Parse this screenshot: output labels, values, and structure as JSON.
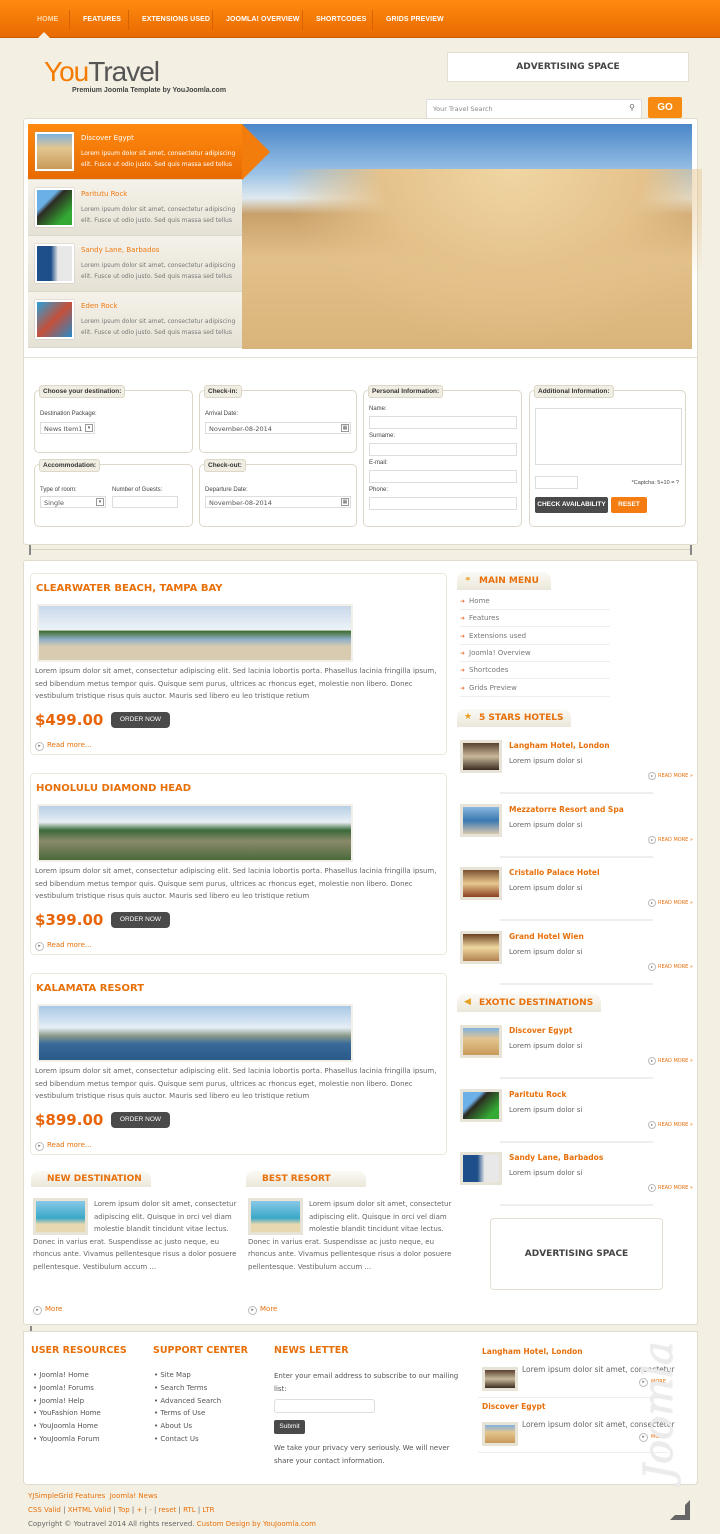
{
  "nav": {
    "items": [
      "Home",
      "Features",
      "Extensions used",
      "Joomla! Overview",
      "Shortcodes",
      "Grids Preview"
    ]
  },
  "header": {
    "logo_a": "You",
    "logo_b": "Travel",
    "tagline": "Premium Joomla Template by YouJoomla.com",
    "ad": "ADVERTISING SPACE",
    "search_placeholder": "Your Travel Search",
    "go": "GO"
  },
  "slider": {
    "items": [
      {
        "title": "Discover Egypt",
        "text": "Lorem ipsum dolor sit amet, consectetur adipiscing elit. Fusce ut odio justo. Sed quis massa sed tellus"
      },
      {
        "title": "Paritutu Rock",
        "text": "Lorem ipsum dolor sit amet, consectetur adipiscing elit. Fusce ut odio justo. Sed quis massa sed tellus"
      },
      {
        "title": "Sandy Lane, Barbados",
        "text": "Lorem ipsum dolor sit amet, consectetur adipiscing elit. Fusce ut odio justo. Sed quis massa sed tellus"
      },
      {
        "title": "Eden Rock",
        "text": "Lorem ipsum dolor sit amet, consectetur adipiscing elit. Fusce ut odio justo. Sed quis massa sed tellus"
      }
    ]
  },
  "booking": {
    "destination": {
      "legend": "Choose your destination:",
      "label": "Destination Package:",
      "value": "News Item1"
    },
    "checkin": {
      "legend": "Check-in:",
      "label": "Arrival Date:",
      "value": "November-08-2014"
    },
    "accommodation": {
      "legend": "Accommodation:",
      "room_label": "Type of room:",
      "room_value": "Single",
      "guests_label": "Number of Guests:"
    },
    "checkout": {
      "legend": "Check-out:",
      "label": "Departure Date:",
      "value": "November-08-2014"
    },
    "personal": {
      "legend": "Personal Information:",
      "name": "Name:",
      "surname": "Surname:",
      "email": "E-mail:",
      "phone": "Phone:"
    },
    "additional": {
      "legend": "Additional Information:",
      "captcha": "*Captcha: 5+10 = ?",
      "check": "CHECK AVAILABILITY",
      "reset": "RESET"
    }
  },
  "articles": [
    {
      "title": "CLEARWATER BEACH, TAMPA BAY",
      "text": "Lorem ipsum dolor sit amet, consectetur adipiscing elit. Sed lacinia lobortis porta. Phasellus lacinia fringilla ipsum, sed bibendum metus tempor quis. Quisque sem purus, ultrices ac rhoncus eget, molestie non libero. Donec vestibulum tristique risus quis auctor. Mauris sed libero eu leo tristique retium",
      "price": "$499.00",
      "order": "ORDER NOW",
      "more": "Read more..."
    },
    {
      "title": "HONOLULU DIAMOND HEAD",
      "text": "Lorem ipsum dolor sit amet, consectetur adipiscing elit. Sed lacinia lobortis porta. Phasellus lacinia fringilla ipsum, sed bibendum metus tempor quis. Quisque sem purus, ultrices ac rhoncus eget, molestie non libero. Donec vestibulum tristique risus quis auctor. Mauris sed libero eu leo tristique retium",
      "price": "$399.00",
      "order": "ORDER NOW",
      "more": "Read more..."
    },
    {
      "title": "KALAMATA RESORT",
      "text": "Lorem ipsum dolor sit amet, consectetur adipiscing elit. Sed lacinia lobortis porta. Phasellus lacinia fringilla ipsum, sed bibendum metus tempor quis. Quisque sem purus, ultrices ac rhoncus eget, molestie non libero. Donec vestibulum tristique risus quis auctor. Mauris sed libero eu leo tristique retium",
      "price": "$899.00",
      "order": "ORDER NOW",
      "more": "Read more..."
    }
  ],
  "sidebar": {
    "main_menu": {
      "title": "MAIN MENU",
      "items": [
        "Home",
        "Features",
        "Extensions used",
        "Joomla! Overview",
        "Shortcodes",
        "Grids Preview"
      ]
    },
    "hotels": {
      "title": "5 STARS HOTELS",
      "items": [
        {
          "title": "Langham Hotel, London",
          "text": "Lorem ipsum dolor si",
          "more": "READ MORE »"
        },
        {
          "title": "Mezzatorre Resort and Spa",
          "text": "Lorem ipsum dolor si",
          "more": "READ MORE »"
        },
        {
          "title": "Cristallo Palace Hotel",
          "text": "Lorem ipsum dolor si",
          "more": "READ MORE »"
        },
        {
          "title": "Grand Hotel Wien",
          "text": "Lorem ipsum dolor si",
          "more": "READ MORE »"
        }
      ]
    },
    "exotic": {
      "title": "EXOTIC DESTINATIONS",
      "items": [
        {
          "title": "Discover Egypt",
          "text": "Lorem ipsum dolor si",
          "more": "READ MORE »"
        },
        {
          "title": "Paritutu Rock",
          "text": "Lorem ipsum dolor si",
          "more": "READ MORE »"
        },
        {
          "title": "Sandy Lane, Barbados",
          "text": "Lorem ipsum dolor si",
          "more": "READ MORE »"
        }
      ]
    },
    "ad": "ADVERTISING SPACE"
  },
  "bottom": [
    {
      "title": "NEW DESTINATION",
      "text": "Lorem ipsum dolor sit amet, consectetur adipiscing elit. Quisque in orci vel diam molestie blandit tincidunt vitae lectus. Donec in varius erat. Suspendisse ac justo neque, eu rhoncus ante. Vivamus pellentesque risus a dolor posuere pellentesque. Vestibulum accum ...",
      "more": "More"
    },
    {
      "title": "BEST RESORT",
      "text": "Lorem ipsum dolor sit amet, consectetur adipiscing elit. Quisque in orci vel diam molestie blandit tincidunt vitae lectus. Donec in varius erat. Suspendisse ac justo neque, eu rhoncus ante. Vivamus pellentesque risus a dolor posuere pellentesque. Vestibulum accum ...",
      "more": "More"
    }
  ],
  "footer_modules": {
    "user_resources": {
      "title": "USER RESOURCES",
      "items": [
        "Joomla! Home",
        "Joomla! Forums",
        "Joomla! Help",
        "YouFashion Home",
        "YouJoomla Home",
        "YouJoomla Forum"
      ]
    },
    "support": {
      "title": "SUPPORT CENTER",
      "items": [
        "Site Map",
        "Search Terms",
        "Advanced Search",
        "Terms of Use",
        "About Us",
        "Contact Us"
      ]
    },
    "newsletter": {
      "title": "NEWS LETTER",
      "intro": "Enter your email address to subscribe to our mailing list:",
      "submit": "Submit",
      "privacy": "We take your privacy very seriously. We will never share your contact information."
    },
    "news": [
      {
        "title": "Langham Hotel, London",
        "text": "Lorem ipsum dolor sit amet, consectetur",
        "more": "MORE"
      },
      {
        "title": "Discover Egypt",
        "text": "Lorem ipsum dolor sit amet, consectetur",
        "more": "MORE"
      }
    ]
  },
  "footer": {
    "links1": [
      "YJSimpleGrid Features",
      "Joomla! News"
    ],
    "links2": [
      "CSS Valid",
      "XHTML Valid",
      "Top",
      "+",
      "-",
      "reset",
      "RTL",
      "LTR"
    ],
    "copyright": "Copyright © Youtravel 2014 All rights reserved.",
    "design": "Custom Design by YouJoomla.com",
    "watermark": "Joomla Fox"
  },
  "colors": {
    "accent": "#f57c00",
    "dark_button": "#4a4a4a"
  }
}
